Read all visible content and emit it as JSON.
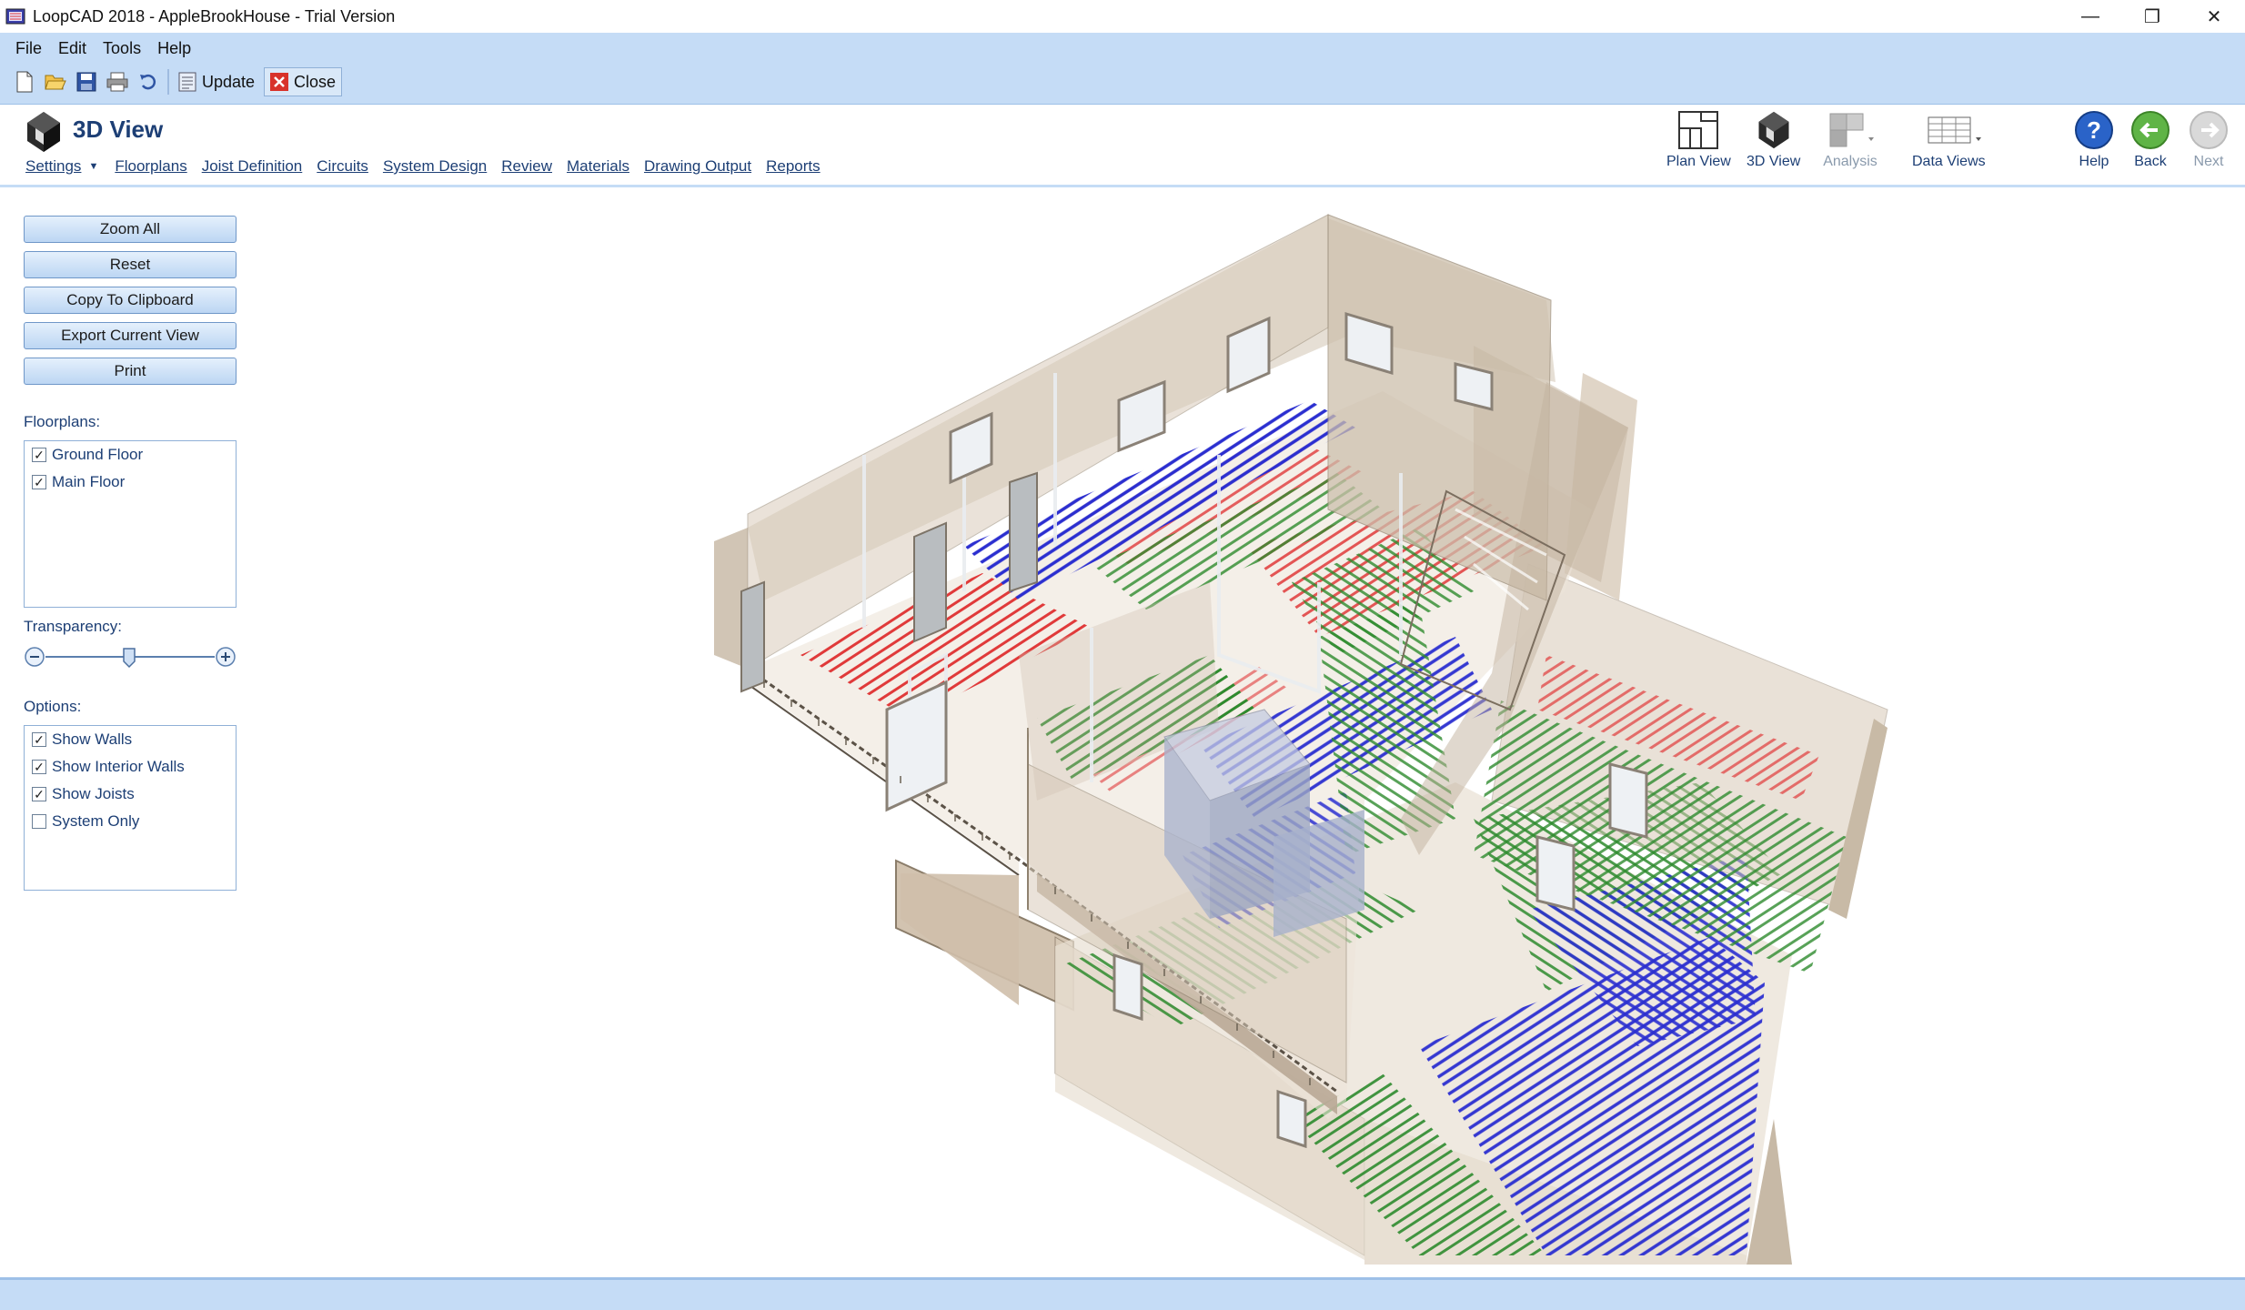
{
  "window": {
    "title": "LoopCAD 2018 - AppleBrookHouse - Trial Version",
    "controls": {
      "minimize": "—",
      "restore": "❐",
      "close": "✕"
    }
  },
  "menu": [
    "File",
    "Edit",
    "Tools",
    "Help"
  ],
  "toolbar": {
    "update_label": "Update",
    "close_label": "Close"
  },
  "nav": {
    "title": "3D View",
    "links": [
      "Settings",
      "Floorplans",
      "Joist Definition",
      "Circuits",
      "System Design",
      "Review",
      "Materials",
      "Drawing Output",
      "Reports"
    ],
    "tools": {
      "plan_view": "Plan View",
      "view_3d": "3D View",
      "analysis": "Analysis",
      "data_views": "Data Views",
      "help": "Help",
      "back": "Back",
      "next": "Next"
    }
  },
  "side": {
    "buttons": [
      "Zoom All",
      "Reset",
      "Copy To Clipboard",
      "Export Current View",
      "Print"
    ],
    "floorplans_label": "Floorplans:",
    "floorplans": [
      {
        "label": "Ground Floor",
        "checked": true
      },
      {
        "label": "Main Floor",
        "checked": true
      }
    ],
    "transparency_label": "Transparency:",
    "transparency_value": 0.5,
    "options_label": "Options:",
    "options": [
      {
        "label": "Show Walls",
        "checked": true
      },
      {
        "label": "Show Interior Walls",
        "checked": true
      },
      {
        "label": "Show Joists",
        "checked": true
      },
      {
        "label": "System Only",
        "checked": false
      }
    ]
  },
  "colors": {
    "menu_bg": "#c5dcf6",
    "nav_text": "#1d3f75",
    "circuit_red": "#e03a3a",
    "circuit_blue": "#2b2fd0",
    "circuit_green": "#2e8b2e",
    "wall": "#cdbfae"
  }
}
